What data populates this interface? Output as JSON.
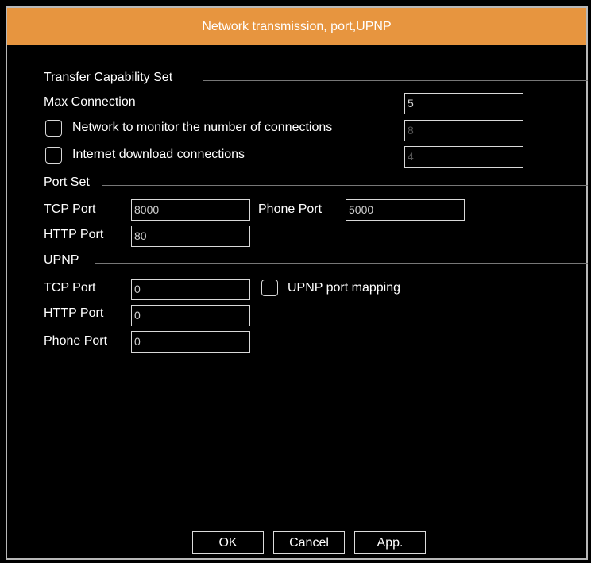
{
  "window": {
    "title": "Network transmission, port,UPNP"
  },
  "transfer": {
    "section_label": "Transfer Capability Set",
    "max_connection_label": "Max Connection",
    "max_connection_value": "5",
    "monitor_connections_label": "Network to monitor the number of connections",
    "monitor_connections_value": "8",
    "download_connections_label": "Internet download connections",
    "download_connections_value": "4"
  },
  "port_set": {
    "section_label": "Port Set",
    "tcp_port_label": "TCP Port",
    "tcp_port_value": "8000",
    "phone_port_label": "Phone Port",
    "phone_port_value": "5000",
    "http_port_label": "HTTP Port",
    "http_port_value": "80"
  },
  "upnp": {
    "section_label": "UPNP",
    "tcp_port_label": "TCP Port",
    "tcp_port_value": "0",
    "mapping_label": "UPNP port mapping",
    "http_port_label": "HTTP Port",
    "http_port_value": "0",
    "phone_port_label": "Phone Port",
    "phone_port_value": "0"
  },
  "footer": {
    "ok_label": "OK",
    "cancel_label": "Cancel",
    "apply_label": "App."
  }
}
